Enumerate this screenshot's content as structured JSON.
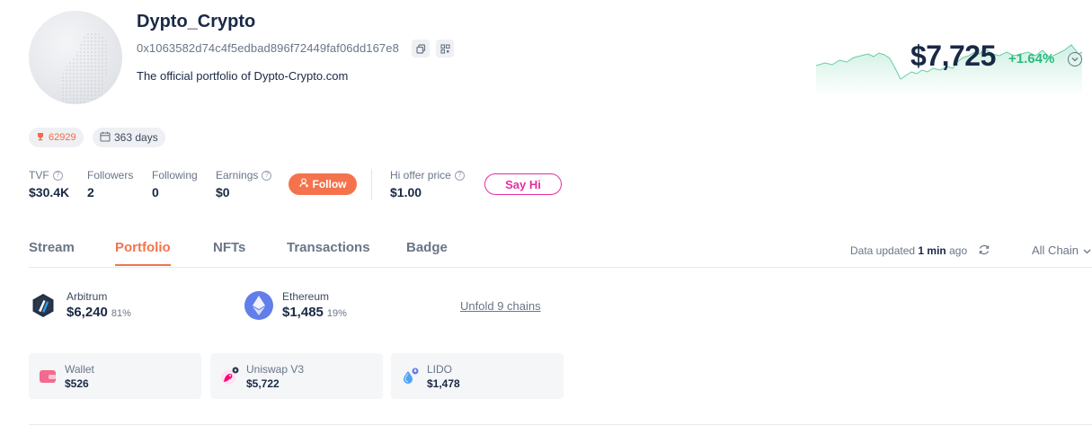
{
  "profile": {
    "name": "Dypto_Crypto",
    "address": "0x1063582d74c4f5edbad896f72449faf06dd167e8",
    "bio": "The official portfolio of Dypto-Crypto.com"
  },
  "net_worth": {
    "value": "$7,725",
    "change": "+1.64%",
    "positive_color": "#2abb7f"
  },
  "badges": {
    "rank": "62929",
    "days": "363 days"
  },
  "stats": [
    {
      "label": "TVF",
      "value": "$30.4K"
    },
    {
      "label": "Followers",
      "value": "2"
    },
    {
      "label": "Following",
      "value": "0"
    },
    {
      "label": "Earnings",
      "value": "$0"
    }
  ],
  "actions": {
    "follow_label": "Follow",
    "hi_offer_label": "Hi offer price",
    "hi_offer_value": "$1.00",
    "say_hi_label": "Say Hi"
  },
  "tabs": [
    {
      "label": "Stream",
      "active": false
    },
    {
      "label": "Portfolio",
      "active": true
    },
    {
      "label": "NFTs",
      "active": false
    },
    {
      "label": "Transactions",
      "active": false
    },
    {
      "label": "Badge",
      "active": false
    }
  ],
  "update_info": {
    "prefix": "Data updated",
    "time": "1 min",
    "suffix": "ago",
    "chain_filter": "All Chain"
  },
  "chains": [
    {
      "name": "Arbitrum",
      "value": "$6,240",
      "percent": "81%",
      "icon": "arbitrum-icon"
    },
    {
      "name": "Ethereum",
      "value": "$1,485",
      "percent": "19%",
      "icon": "ethereum-icon"
    }
  ],
  "unfold_label": "Unfold 9 chains",
  "protocols": [
    {
      "name": "Wallet",
      "value": "$526",
      "icon": "wallet-icon"
    },
    {
      "name": "Uniswap V3",
      "value": "$5,722",
      "icon": "uniswap-icon"
    },
    {
      "name": "LIDO",
      "value": "$1,478",
      "icon": "lido-icon"
    }
  ],
  "colors": {
    "accent": "#f4734d",
    "say_hi": "#e62d9f",
    "text": "#192945",
    "muted": "#6a7587"
  }
}
